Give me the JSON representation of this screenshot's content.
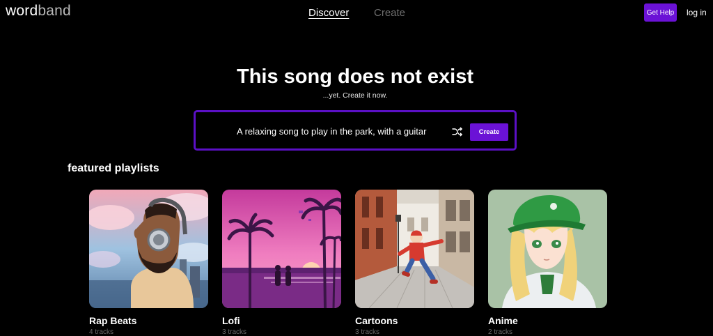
{
  "header": {
    "logo_part1": "word",
    "logo_part2": "band",
    "nav": {
      "discover": "Discover",
      "create": "Create"
    },
    "help_label": "Get Help",
    "login_label": "log in"
  },
  "hero": {
    "title": "This song does not exist",
    "subtitle": "...yet. Create it now."
  },
  "prompt": {
    "text": "A relaxing song to play in the park, with a guitar",
    "shuffle_icon": "shuffle-icon",
    "create_label": "Create"
  },
  "featured": {
    "title": "featured playlists",
    "playlists": [
      {
        "title": "Rap Beats",
        "count": "4 tracks",
        "cover": "man-with-headphones"
      },
      {
        "title": "Lofi",
        "count": "3 tracks",
        "cover": "sunset-palm-beach"
      },
      {
        "title": "Cartoons",
        "count": "3 tracks",
        "cover": "cartoon-boy-running-street"
      },
      {
        "title": "Anime",
        "count": "2 tracks",
        "cover": "anime-girl-green-cap"
      }
    ]
  },
  "colors": {
    "accent": "#6b12d6",
    "background": "#000000",
    "muted_text": "#6f6f6f"
  }
}
